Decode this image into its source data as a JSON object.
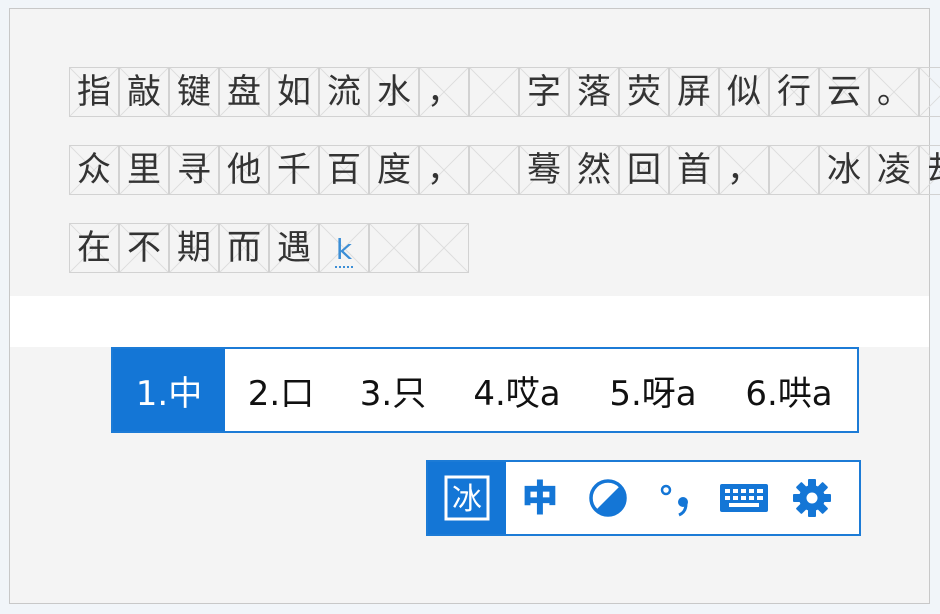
{
  "composition": {
    "lines": [
      [
        "指",
        "敲",
        "键",
        "盘",
        "如",
        "流",
        "水",
        "，",
        "",
        "字",
        "落",
        "荧",
        "屏",
        "似",
        "行",
        "云",
        "。",
        ""
      ],
      [
        "众",
        "里",
        "寻",
        "他",
        "千",
        "百",
        "度",
        "，",
        "",
        "蓦",
        "然",
        "回",
        "首",
        "，",
        "",
        "冰",
        "凌",
        "却"
      ],
      [
        "在",
        "不",
        "期",
        "而",
        "遇",
        "k",
        "",
        ""
      ]
    ],
    "input_char": "k"
  },
  "candidates": [
    {
      "label": "1.中",
      "selected": true
    },
    {
      "label": "2.口",
      "selected": false
    },
    {
      "label": "3.只",
      "selected": false
    },
    {
      "label": "4.哎a",
      "selected": false
    },
    {
      "label": "5.呀a",
      "selected": false
    },
    {
      "label": "6.哄a",
      "selected": false
    }
  ],
  "toolbar": {
    "logo_char": "冰",
    "mode_label": "中",
    "icons": [
      "logo-icon",
      "chinese-mode-icon",
      "half-width-icon",
      "punctuation-icon",
      "keyboard-icon",
      "settings-gear-icon"
    ]
  },
  "colors": {
    "accent": "#1476d6",
    "composition_blue": "#3b8ed6",
    "grid": "#d2d2d2"
  }
}
